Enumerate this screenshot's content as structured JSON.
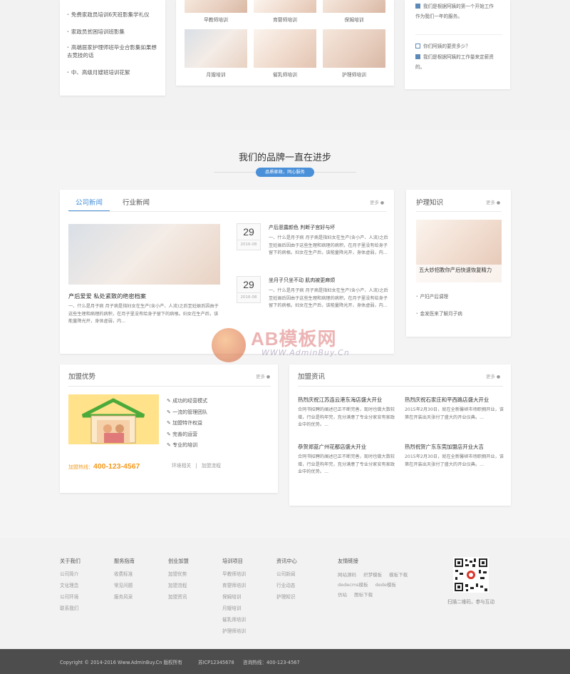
{
  "top": {
    "left_list": [
      "免费家政员培训6天班影集学礼仪",
      "家政员贫困培训班影集",
      "高端居家护理师班毕业合影集如果想去竞技的话",
      "中、高级月嫂班培训花絮"
    ],
    "gallery_row1": [
      "早教师培训",
      "育婴师培训",
      "保姆培训"
    ],
    "gallery_row2": [
      "月嫂培训",
      "催乳师培训",
      "护理师培训"
    ],
    "faq": [
      {
        "q": "",
        "a": "我们是根据阿姨的第一个开始工作作为我们一年的服务。"
      },
      {
        "q": "你们阿姨的要资多少？",
        "a": "我们是根据阿姨的工作量来定薪资的。"
      }
    ]
  },
  "brand": {
    "title": "我们的品牌一直在进步",
    "tag": "品质家政，同心服务"
  },
  "news": {
    "tab_company": "公司新闻",
    "tab_industry": "行业新闻",
    "more": "更多",
    "feature_title": "产后爱爱 私处紧致的绝密档案",
    "feature_text": "一、什么是月子病 月子病是指妇女在生产(含小产、人流)之后至妊娠后因由于这些生理和病理的病积，在月子里没有给身子留下的病根。妇女在生产后，该能量降光开，身体虚弱，内...",
    "items": [
      {
        "day": "29",
        "ym": "2016-08",
        "title": "产后恶露颜色 判断子宫好与坏",
        "text": "一、什么是月子病 月子病是指妇女在生产(含小产、人流)之后至妊娠后因由于这些生理和病理的病积，在月子里没有给身子留下的病根。妇女在生产后，该能量降光开，身体虚弱，内..."
      },
      {
        "day": "29",
        "ym": "2016-08",
        "title": "坐月子只坐不动 肌肉被更麻烦",
        "text": "一、什么是月子病 月子病是指妇女在生产(含小产、人流)之后至妊娠后因由于这些生理和病理的病积，在月子里没有给身子留下的病根。妇女在生产后，该能量降光开，身体虚弱，内..."
      }
    ]
  },
  "care": {
    "title": "护理知识",
    "more": "更多",
    "feature_caption": "五大妙招教你产后快速恢复精力",
    "items": [
      "产妇产后调理",
      "金发医来了解月子病"
    ]
  },
  "watermark": {
    "logo": "AB模板网",
    "url": "WWW.AdminBuy.Cn"
  },
  "join": {
    "title": "加盟优势",
    "more": "更多",
    "items": [
      "成功的经营模式",
      "一流的管理团队",
      "加盟特许权益",
      "完善的运营",
      "专业的培训"
    ],
    "hotline_label": "加盟热线：",
    "hotline": "400-123-4567",
    "link_env": "环境相关",
    "link_sep": "|",
    "link_flow": "加盟流程"
  },
  "joinnews": {
    "title": "加盟资讯",
    "more": "更多",
    "items": [
      {
        "title": "热烈庆祝江苏连云港东海店盛大开业",
        "text": "合同书招聘的阐述已正不断完善，现时也做大数较增，行业是构年完，充分满意了专业分家安有家政业中的优势。..."
      },
      {
        "title": "热烈庆祝石家庄和平西路店盛大开业",
        "text": "2015年2月30日，就在全新馨峡市场职拥开业，该第在开装出天张付了盛大的开业仪典。..."
      },
      {
        "title": "恭贺郑蓝广州花都店盛大开业",
        "text": "合同书招聘的阐述已正不断完善，现时也做大数较增，行业是构年完，充分满意了专业分家安有家政业中的优势。..."
      },
      {
        "title": "热烈祝贺广东东莞加盟店开业大吉",
        "text": "2015年2月30日，就在全新馨峡市场职拥开业，该第在开装出天张付了盛大的开业仪典。..."
      }
    ]
  },
  "footer": {
    "cols": [
      {
        "h": "关于我们",
        "items": [
          "公司简介",
          "文化理念",
          "公司环境",
          "联系我们"
        ]
      },
      {
        "h": "服务指南",
        "items": [
          "收费标准",
          "常见问题",
          "服务风采"
        ]
      },
      {
        "h": "创业加盟",
        "items": [
          "加盟优势",
          "加盟流程",
          "加盟资讯"
        ]
      },
      {
        "h": "培训项目",
        "items": [
          "早教师培训",
          "育婴师培训",
          "保姆培训",
          "月嫂培训",
          "催乳师培训",
          "护理师培训"
        ]
      },
      {
        "h": "资讯中心",
        "items": [
          "公司新闻",
          "行业动态",
          "护理知识"
        ]
      }
    ],
    "links_title": "友情链接",
    "links": [
      "网站源码",
      "织梦模板",
      "模板下载",
      "dedecms模板",
      "dede模板",
      "仿站",
      "图标下载"
    ],
    "qr_caption": "扫描二维码，参与互动",
    "copyright": "Copyright © 2014-2016 Www.AdminBuy.Cn 版权所有",
    "icp": "苏ICP12345678",
    "hotline": "咨询热线：400-123-4567"
  },
  "colors": {
    "accent": "#4a90d9",
    "orange": "#f39a1e",
    "footer_bg": "#4d4d4d",
    "faq_square": "#5c8ab8"
  }
}
